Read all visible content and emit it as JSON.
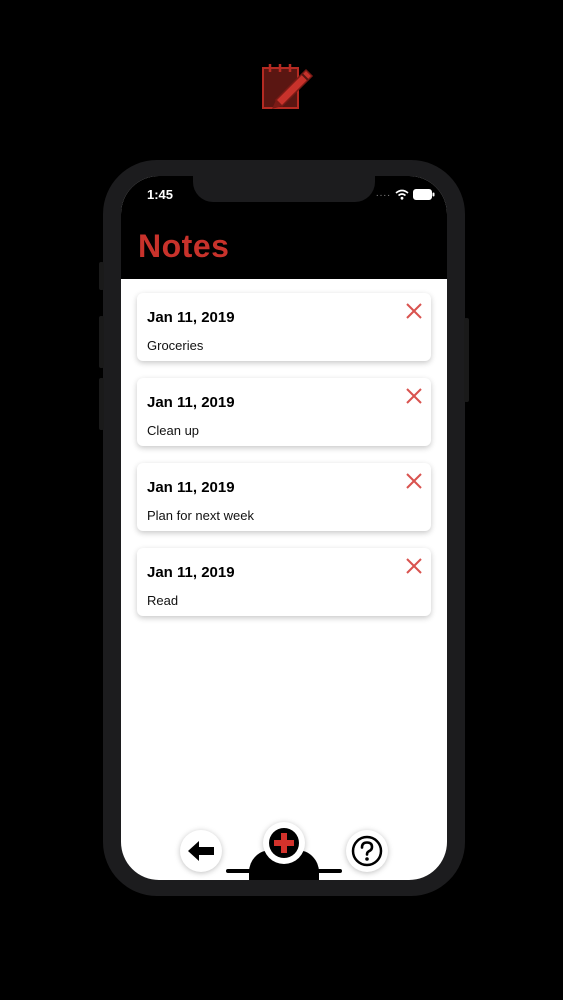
{
  "app": {
    "title": "Notes",
    "accent_color": "#c8322b",
    "logo_icon": "notepad-pencil-icon"
  },
  "status_bar": {
    "time": "1:45",
    "signal": "....",
    "icons": [
      "wifi-icon",
      "battery-icon"
    ]
  },
  "notes": [
    {
      "date": "Jan 11, 2019",
      "text": "Groceries"
    },
    {
      "date": "Jan 11, 2019",
      "text": "Clean up"
    },
    {
      "date": "Jan 11, 2019",
      "text": "Plan for next week"
    },
    {
      "date": "Jan 11, 2019",
      "text": "Read"
    }
  ],
  "toolbar": {
    "icons": [
      "back-arrow-icon",
      "add-note-icon",
      "help-icon"
    ]
  }
}
